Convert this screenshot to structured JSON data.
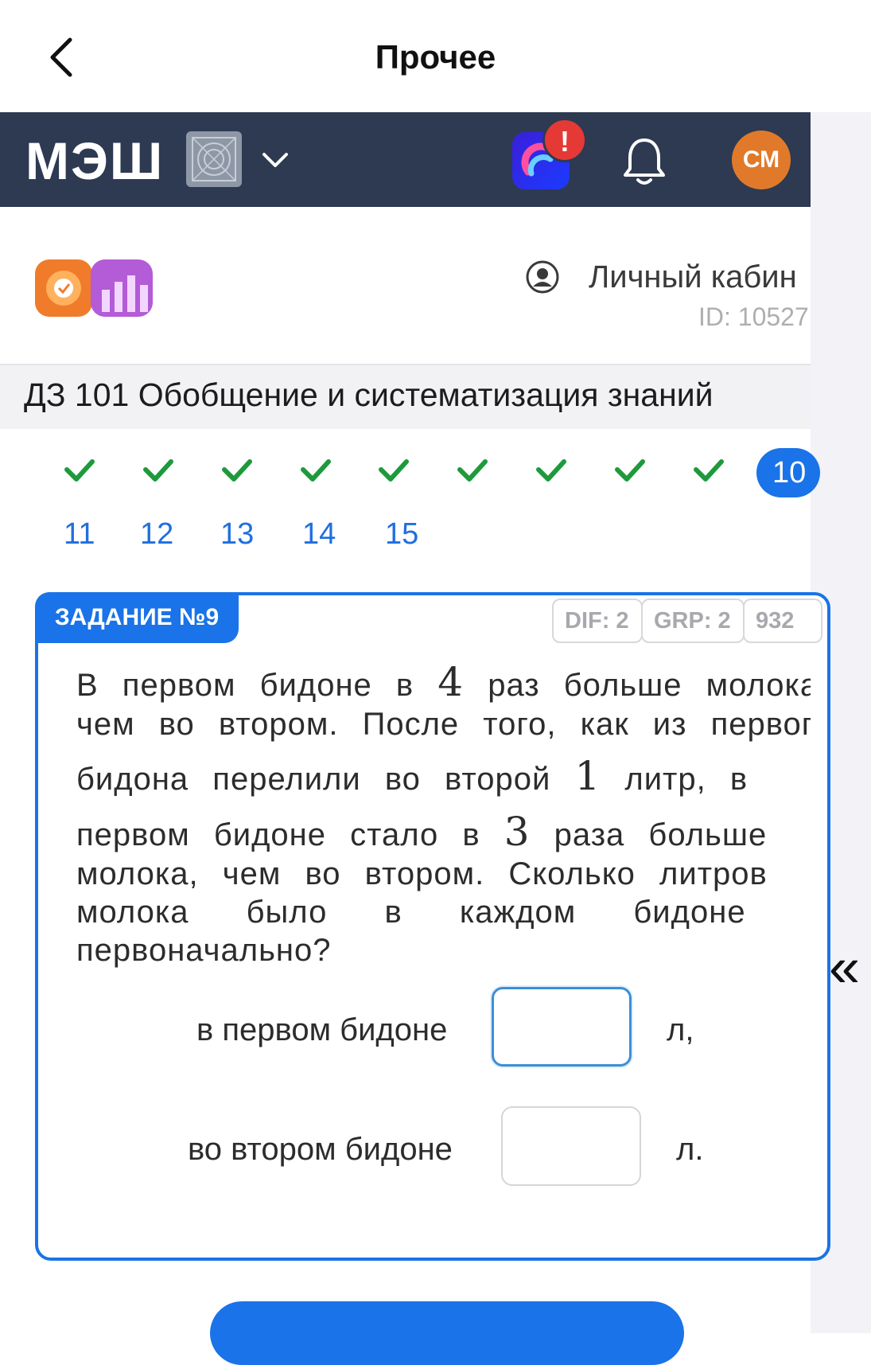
{
  "topbar": {
    "title": "Прочее"
  },
  "header": {
    "logo": "МЭШ",
    "alert_badge": "!",
    "avatar_initials": "СМ"
  },
  "subheader": {
    "cabinet_label": "Личный кабин",
    "user_id": "ID: 10527"
  },
  "assignment": {
    "title": "ДЗ 101 Обобщение и систематизация знаний"
  },
  "task_nav": {
    "completed": [
      1,
      2,
      3,
      4,
      5,
      6,
      7,
      8,
      9
    ],
    "current": "10",
    "remaining": [
      "11",
      "12",
      "13",
      "14",
      "15"
    ]
  },
  "task": {
    "tab_label": "ЗАДАНИЕ №9",
    "dif": "DIF: 2",
    "grp": "GRP: 2",
    "code": "932",
    "lines": [
      [
        "В первом бидоне в ",
        "4",
        " раз больше молока"
      ],
      [
        "чем во втором. После того, как из первого",
        "",
        ""
      ],
      [
        "бидона перелили во второй ",
        "1",
        " литр, в"
      ],
      [
        "первом бидоне стало в ",
        "3",
        " раза больше"
      ],
      [
        "молока, чем во втором. Сколько литров",
        "",
        ""
      ],
      [
        "молока было в каждом бидоне",
        "",
        ""
      ],
      [
        "первоначально?",
        "",
        ""
      ]
    ],
    "answers": [
      {
        "label": "в первом бидоне",
        "value": "",
        "unit": "л,"
      },
      {
        "label": "во втором бидоне",
        "value": "",
        "unit": "л."
      }
    ]
  },
  "colors": {
    "accent": "#1a73e8",
    "header_bg": "#2d3a52",
    "check": "#1e9a3c",
    "avatar": "#e07a2a",
    "alert": "#e53935"
  }
}
